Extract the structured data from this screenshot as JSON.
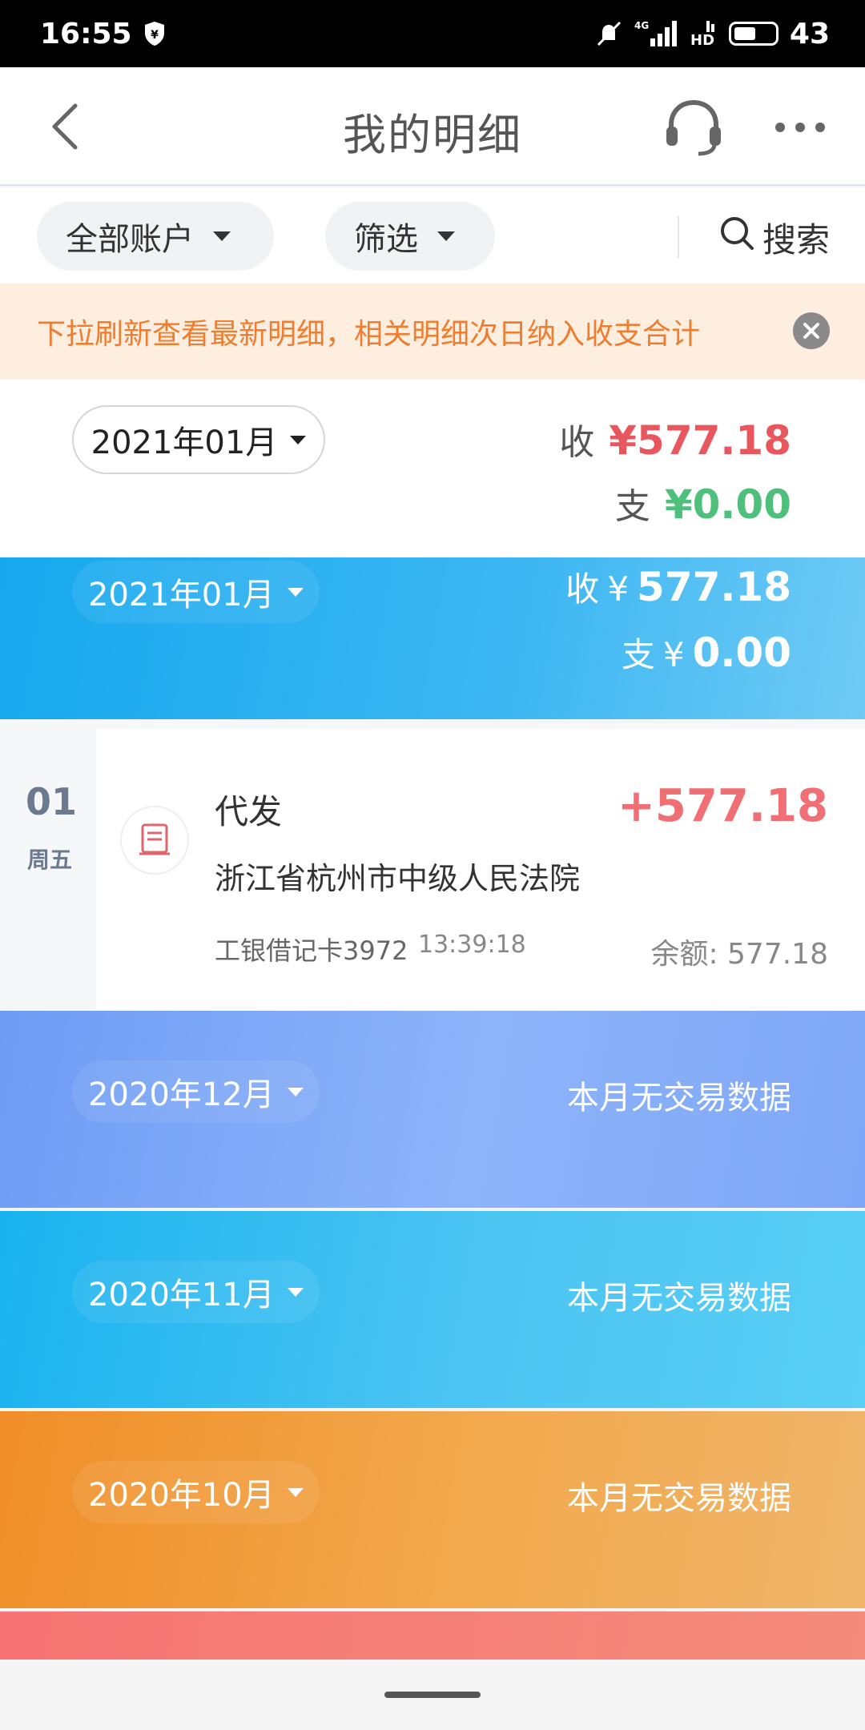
{
  "status_bar": {
    "time": "16:55",
    "signal_label": "4G",
    "hd_label": "HD",
    "battery": "43"
  },
  "header": {
    "title": "我的明细",
    "back_icon": "back-arrow-icon",
    "support_icon": "headset-icon",
    "more_icon": "more-icon"
  },
  "filters": {
    "account_label": "全部账户",
    "filter_label": "筛选",
    "search_label": "搜索"
  },
  "notice": {
    "text": "下拉刷新查看最新明细，相关明细次日纳入收支合计"
  },
  "summary": {
    "month": "2021年01月",
    "income_label": "收",
    "income_value": "¥577.18",
    "expense_label": "支",
    "expense_value": "¥0.00"
  },
  "months": [
    {
      "month": "2021年01月",
      "income_label": "收",
      "income_currency": "¥",
      "income_value": "577.18",
      "expense_label": "支",
      "expense_currency": "¥",
      "expense_value": "0.00"
    },
    {
      "month": "2020年12月",
      "status": "本月无交易数据"
    },
    {
      "month": "2020年11月",
      "status": "本月无交易数据"
    },
    {
      "month": "2020年10月",
      "status": "本月无交易数据"
    }
  ],
  "transaction": {
    "day": "01",
    "weekday": "周五",
    "type": "代发",
    "amount": "+577.18",
    "payer": "浙江省杭州市中级人民法院",
    "card": "工银借记卡3972",
    "time": "13:39:18",
    "balance": "余额: 577.18"
  },
  "colors": {
    "income": "#e9575e",
    "expense": "#4fc07b",
    "notice_bg": "#fdeee0",
    "notice_text": "#ef7d2f"
  }
}
